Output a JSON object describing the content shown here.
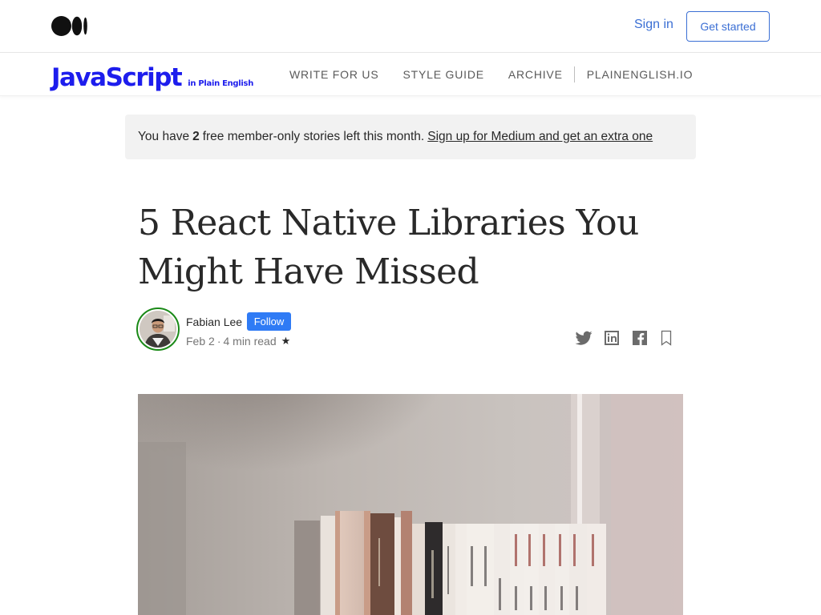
{
  "header": {
    "signin_label": "Sign in",
    "get_started_label": "Get started"
  },
  "publication": {
    "logo_main": "JavaScript",
    "logo_sub": "in Plain English",
    "nav": [
      "WRITE FOR US",
      "STYLE GUIDE",
      "ARCHIVE",
      "PLAINENGLISH.IO"
    ]
  },
  "banner": {
    "prefix": "You have",
    "count": "2",
    "suffix": "free member-only stories left this month.",
    "link": "Sign up for Medium and get an extra one"
  },
  "article": {
    "title_line1": "5 React Native Libraries You",
    "title_line2": "Might Have Missed",
    "author": "Fabian Lee",
    "follow_label": "Follow",
    "date": "Feb 2",
    "separator": "·",
    "read_time": "4 min read",
    "star": "★"
  },
  "icons": {
    "social": [
      "twitter-icon",
      "linkedin-icon",
      "facebook-icon",
      "bookmark-icon"
    ]
  },
  "colors": {
    "accent_blue": "#3b6fd4",
    "publication_blue": "#1d1ded",
    "follow_blue": "#2f7bf5",
    "avatar_ring": "#1a8917"
  }
}
